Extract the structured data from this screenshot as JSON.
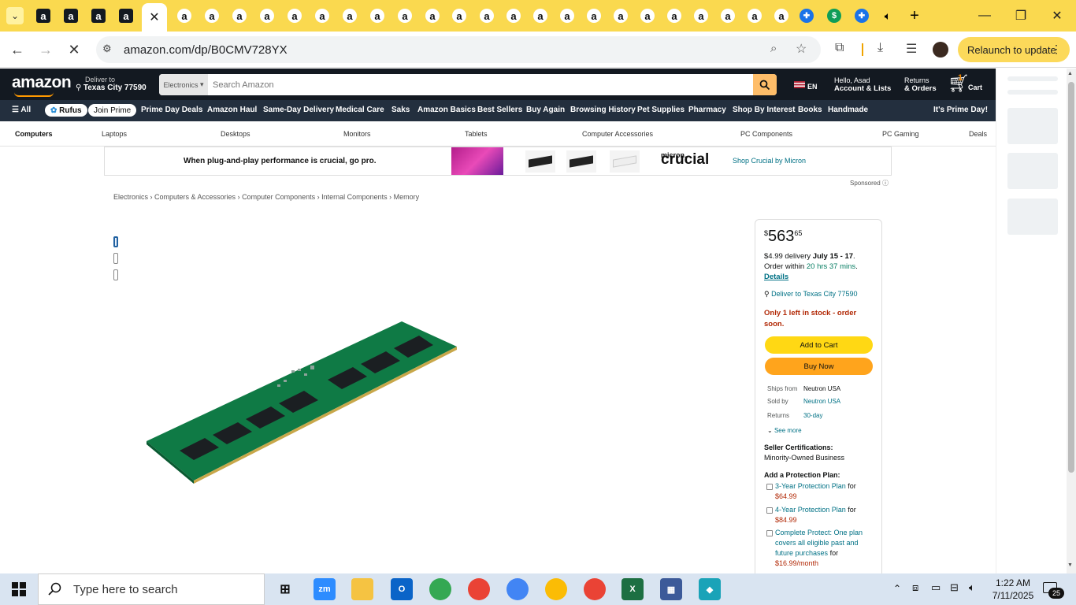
{
  "browser": {
    "tab_menu_icon": "chevron-down-icon",
    "tabs": [
      {
        "favicon": "a",
        "style": "dark"
      },
      {
        "favicon": "a",
        "style": "dark"
      },
      {
        "favicon": "a",
        "style": "dark"
      },
      {
        "favicon": "a",
        "style": "dark"
      }
    ],
    "active_tab_close": "✕",
    "light_tab_glyph": "a",
    "url": "amazon.com/dp/B0CMV728YX",
    "relaunch_label": "Relaunch to update",
    "new_tab": "+"
  },
  "amazon": {
    "logo": "amazon",
    "deliver_to_label": "Deliver to",
    "deliver_to_location": "Texas City 77590",
    "search_category": "Electronics",
    "search_placeholder": "Search Amazon",
    "language": "EN",
    "account_line1": "Hello, Asad",
    "account_line2": "Account & Lists",
    "returns_line1": "Returns",
    "returns_line2": "& Orders",
    "cart_count": "1",
    "cart_label": "Cart",
    "subnav": {
      "all": "All",
      "rufus": "Rufus",
      "join_prime": "Join Prime",
      "items": [
        "Prime Day Deals",
        "Amazon Haul",
        "Same-Day Delivery",
        "Medical Care",
        "Saks",
        "Amazon Basics",
        "Best Sellers",
        "Buy Again",
        "Browsing History",
        "Pet Supplies",
        "Pharmacy",
        "Shop By Interest",
        "Books",
        "Handmade"
      ],
      "promo": "It's Prime Day!"
    },
    "catnav": [
      "Computers",
      "Laptops",
      "Desktops",
      "Monitors",
      "Tablets",
      "Computer Accessories",
      "PC Components",
      "PC Gaming",
      "Deals"
    ],
    "banner": {
      "headline": "When plug-and-play performance is crucial, go pro.",
      "brand_top": "micron.",
      "brand": "crucial",
      "link": "Shop Crucial by Micron",
      "sponsored": "Sponsored"
    },
    "breadcrumb": [
      "Electronics",
      "Computers & Accessories",
      "Computer Components",
      "Internal Components",
      "Memory"
    ],
    "buybox": {
      "price_symbol": "$",
      "price_whole": "563",
      "price_fraction": "65",
      "delivery_fee": "$4.99 delivery",
      "delivery_dates": "July 15 - 17",
      "order_within_label": "Order within",
      "order_within_time": "20 hrs 37 mins",
      "details": "Details",
      "deliver_to": "Deliver to Texas City 77590",
      "stock": "Only 1 left in stock - order soon.",
      "add_to_cart": "Add to Cart",
      "buy_now": "Buy Now",
      "ships_from_label": "Ships from",
      "ships_from_value": "Neutron USA",
      "sold_by_label": "Sold by",
      "sold_by_value": "Neutron USA",
      "returns_label": "Returns",
      "returns_value": "30-day",
      "see_more": "See more",
      "seller_cert_label": "Seller Certifications:",
      "seller_cert_value": "Minority-Owned Business",
      "protection_label": "Add a Protection Plan:",
      "plans": [
        {
          "name": "3-Year Protection Plan",
          "for": "for",
          "price": "$64.99"
        },
        {
          "name": "4-Year Protection Plan",
          "for": "for",
          "price": "$84.99"
        },
        {
          "name": "Complete Protect: One plan covers all eligible past and future purchases",
          "for": "for",
          "price": "$16.99/month"
        }
      ]
    }
  },
  "taskbar": {
    "search_placeholder": "Type here to search",
    "apps": [
      {
        "name": "zoom",
        "label": "zm",
        "color": "#2d8cff"
      },
      {
        "name": "file-explorer",
        "label": "",
        "color": "#f5c342"
      },
      {
        "name": "outlook",
        "label": "O",
        "color": "#0a64c8"
      },
      {
        "name": "chrome-1",
        "label": "",
        "color": "#34a853"
      },
      {
        "name": "chrome-2",
        "label": "",
        "color": "#ea4335"
      },
      {
        "name": "chrome-3",
        "label": "",
        "color": "#4285f4"
      },
      {
        "name": "chrome-4",
        "label": "",
        "color": "#fbbc05"
      },
      {
        "name": "chrome-5",
        "label": "",
        "color": "#ea4335"
      },
      {
        "name": "excel",
        "label": "X",
        "color": "#1d6f42"
      },
      {
        "name": "calculator",
        "label": "▦",
        "color": "#3c5a99"
      },
      {
        "name": "app-diamond",
        "label": "◆",
        "color": "#1aa3b8"
      }
    ],
    "time": "1:22 AM",
    "date": "7/11/2025",
    "notifications": "25"
  }
}
